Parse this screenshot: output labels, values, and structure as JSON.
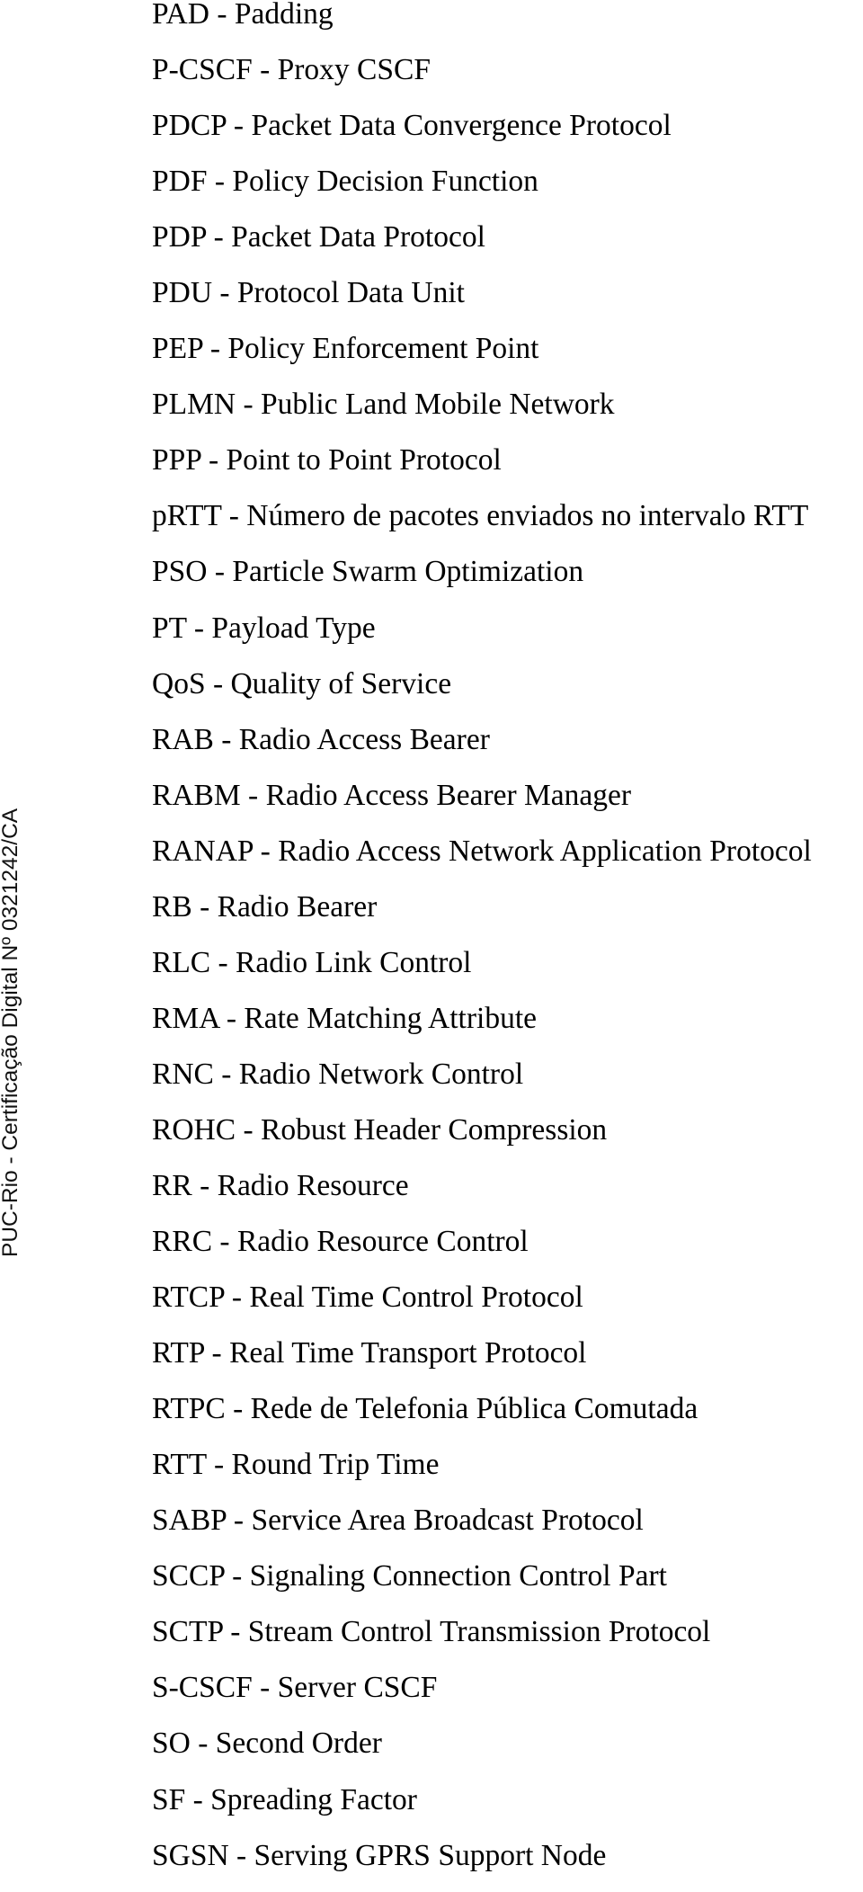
{
  "watermark": {
    "text": "PUC-Rio - Certificação Digital Nº 0321242/CA"
  },
  "abbreviations": [
    {
      "text": "PAD - Padding"
    },
    {
      "text": "P-CSCF - Proxy CSCF"
    },
    {
      "text": "PDCP - Packet Data Convergence Protocol"
    },
    {
      "text": "PDF - Policy Decision Function"
    },
    {
      "text": "PDP - Packet Data Protocol"
    },
    {
      "text": "PDU - Protocol Data Unit"
    },
    {
      "text": "PEP - Policy Enforcement Point"
    },
    {
      "text": "PLMN - Public Land Mobile Network"
    },
    {
      "text": "PPP - Point to Point Protocol"
    },
    {
      "text": "pRTT - Número de pacotes enviados no intervalo RTT"
    },
    {
      "text": "PSO - Particle Swarm Optimization"
    },
    {
      "text": "PT - Payload Type"
    },
    {
      "text": "QoS - Quality of Service"
    },
    {
      "text": "RAB - Radio Access Bearer"
    },
    {
      "text": "RABM - Radio Access Bearer Manager"
    },
    {
      "text": "RANAP - Radio Access Network Application Protocol"
    },
    {
      "text": "RB - Radio Bearer"
    },
    {
      "text": "RLC - Radio Link Control"
    },
    {
      "text": "RMA - Rate Matching Attribute"
    },
    {
      "text": "RNC - Radio Network Control"
    },
    {
      "text": "ROHC - Robust Header Compression"
    },
    {
      "text": "RR - Radio Resource"
    },
    {
      "text": "RRC - Radio Resource Control"
    },
    {
      "text": "RTCP - Real Time Control Protocol"
    },
    {
      "text": "RTP - Real Time Transport Protocol"
    },
    {
      "text": "RTPC - Rede de Telefonia Pública Comutada"
    },
    {
      "text": "RTT - Round Trip Time"
    },
    {
      "text": "SABP - Service Area Broadcast Protocol"
    },
    {
      "text": "SCCP - Signaling Connection Control Part"
    },
    {
      "text": "SCTP - Stream Control Transmission Protocol"
    },
    {
      "text": "S-CSCF - Server CSCF"
    },
    {
      "text": "SO - Second Order"
    },
    {
      "text": "SF - Spreading Factor"
    },
    {
      "text": "SGSN - Serving GPRS Support Node"
    }
  ]
}
